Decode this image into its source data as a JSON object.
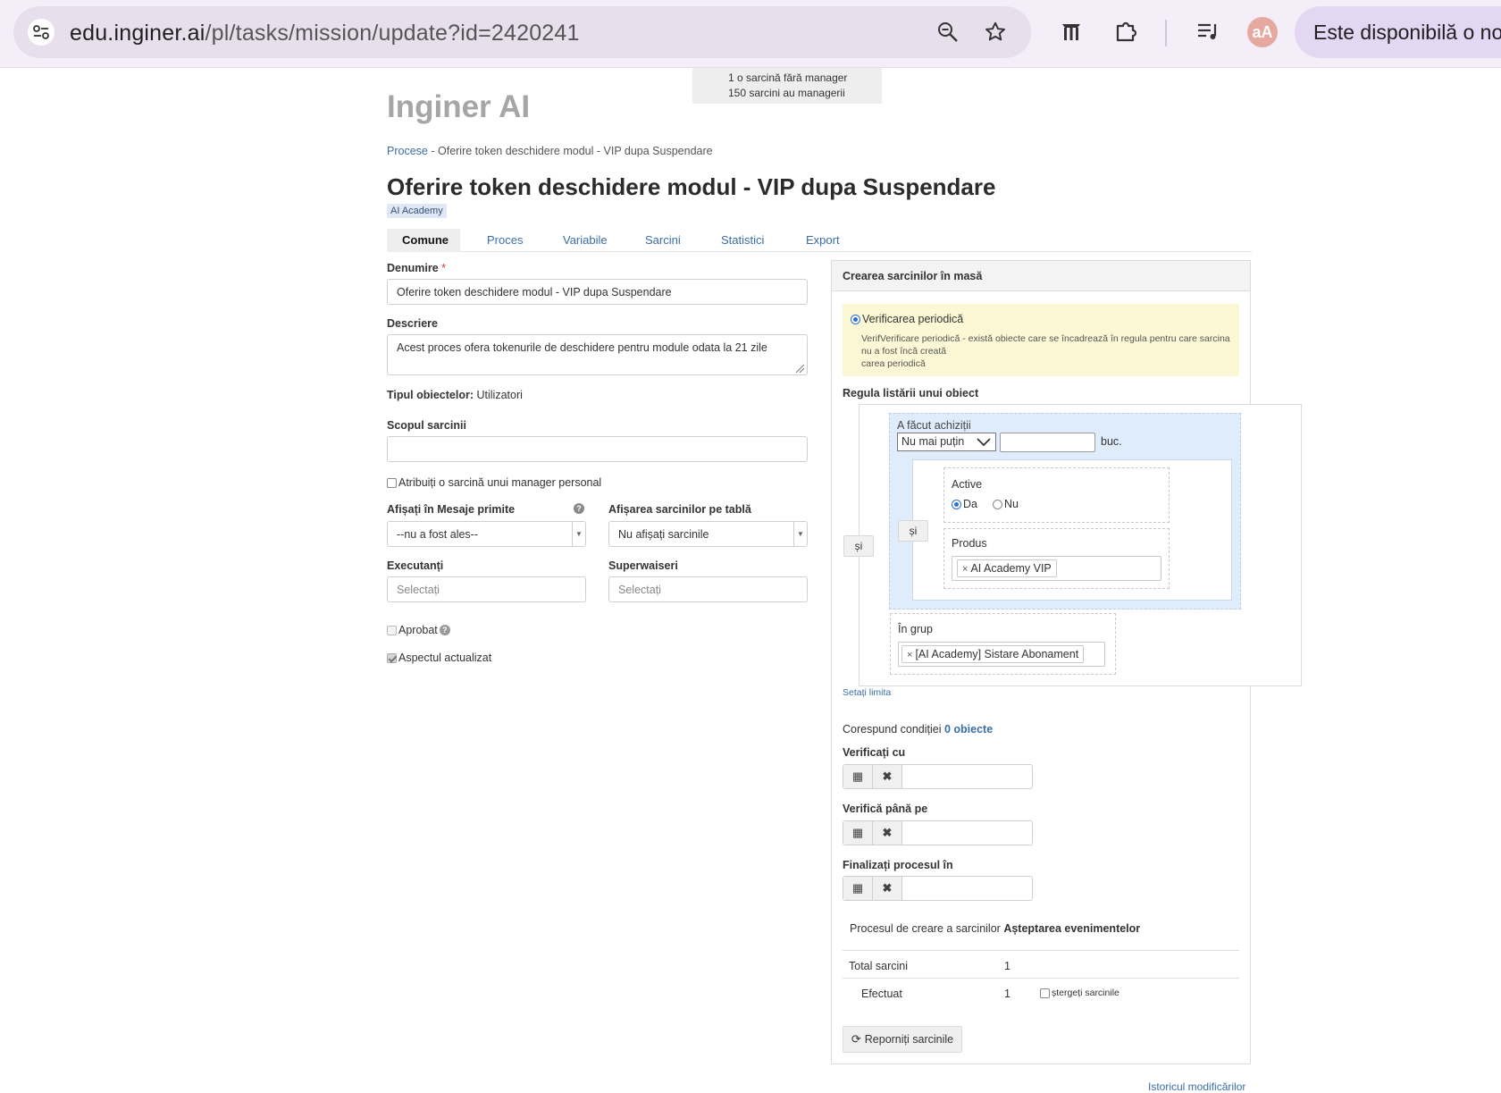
{
  "browser": {
    "url_host": "edu.inginer.ai",
    "url_path": "/pl/tasks/mission/update?id=2420241",
    "avatar_text": "aA",
    "banner_text": "Este disponibilă o no"
  },
  "info_box": {
    "line1": "1 o sarcină fără manager",
    "line2": "150 sarcini au managerii"
  },
  "logo": "Inginer AI",
  "breadcrumb": {
    "root": "Procese",
    "separator": "-",
    "current": "Oferire token deschidere modul - VIP dupa Suspendare"
  },
  "page_title": "Oferire token deschidere modul - VIP dupa Suspendare",
  "tag": "AI Academy",
  "tabs": [
    {
      "label": "Comune",
      "active": true
    },
    {
      "label": "Proces",
      "active": false
    },
    {
      "label": "Variabile",
      "active": false
    },
    {
      "label": "Sarcini",
      "active": false
    },
    {
      "label": "Statistici",
      "active": false
    },
    {
      "label": "Export",
      "active": false
    }
  ],
  "form": {
    "name_label": "Denumire",
    "name_required": "*",
    "name_value": "Oferire token deschidere modul - VIP dupa Suspendare",
    "desc_label": "Descriere",
    "desc_value": "Acest proces ofera tokenurile de deschidere pentru module odata la 21 zile",
    "object_type_label": "Tipul obiectelor:",
    "object_type_value": "Utilizatori",
    "scope_label": "Scopul sarcinii",
    "scope_value": "",
    "assign_manager_label": "Atribuiți o sarcină unui manager personal",
    "inbox_label": "Afișați în Mesaje primite",
    "inbox_value": "--nu a fost ales--",
    "board_label": "Afișarea sarcinilor pe tablă",
    "board_value": "Nu afișați sarcinile",
    "executors_label": "Executanți",
    "executors_placeholder": "Selectați",
    "supervisors_label": "Superwaiseri",
    "supervisors_placeholder": "Selectați",
    "approved_label": "Aprobat",
    "updated_label": "Aspectul actualizat"
  },
  "panel": {
    "title": "Crearea sarcinilor în masă",
    "periodic_label": "Verificarea periodică",
    "periodic_desc_1": "VerifVerificare periodică - există obiecte care se încadrează în regula pentru care sarcina",
    "periodic_desc_2": "nu a fost încă creată",
    "periodic_desc_3": "carea periodică",
    "rule_label": "Regula listării unui obiect",
    "and_label": "și",
    "purchases_label": "A făcut achiziții",
    "purchases_select": "Nu mai puțin",
    "purchases_qty": "",
    "purchases_unit": "buc.",
    "active_label": "Active",
    "active_yes": "Da",
    "active_no": "Nu",
    "product_label": "Produs",
    "product_chip": "AI Academy VIP",
    "group_label": "În grup",
    "group_chip": "[AI Academy] Sistare Abonament",
    "set_limit": "Setați limita",
    "match_text": "Corespund condiției",
    "match_count": "0 obiecte",
    "check_from_label": "Verificați cu",
    "check_until_label": "Verifică până pe",
    "finish_label": "Finalizați procesul în",
    "creation_process_text": "Procesul de creare a sarcinilor",
    "creation_process_status": "Așteptarea evenimentelor",
    "total_label": "Total sarcini",
    "total_value": "1",
    "done_label": "Efectuat",
    "done_value": "1",
    "delete_tasks_label": "ștergeți sarcinile",
    "restart_button": "Reporniți sarcinile",
    "history_link": "Istoricul modificărilor"
  }
}
